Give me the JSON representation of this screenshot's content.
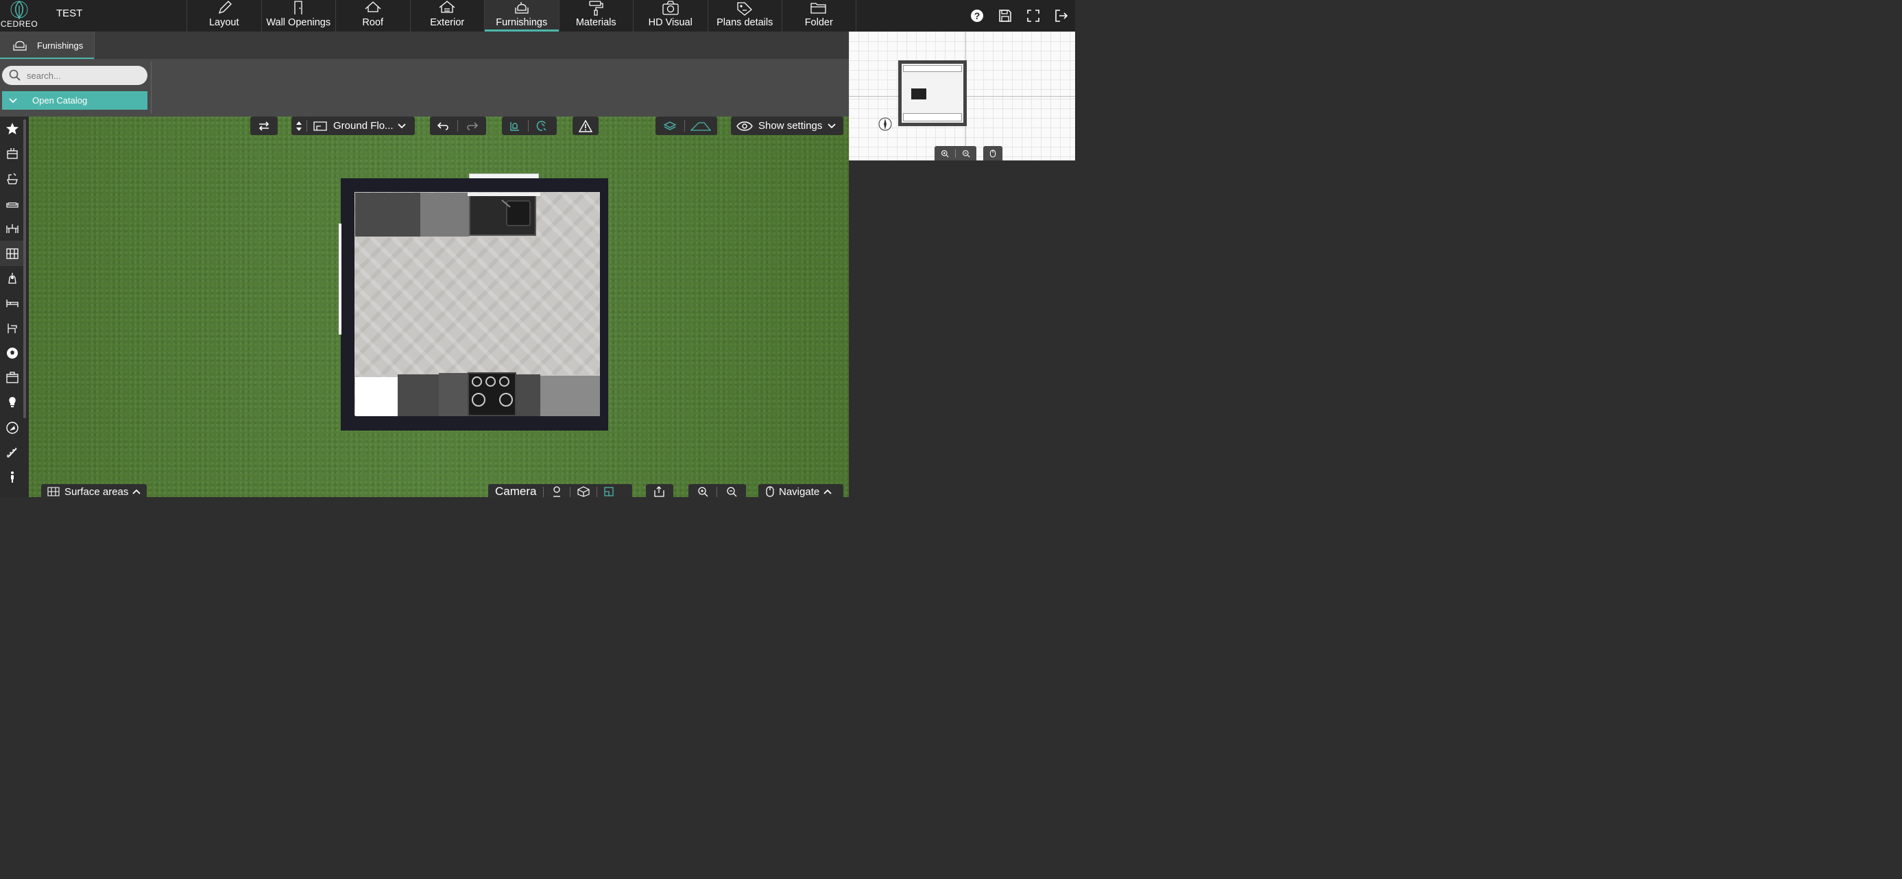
{
  "app": {
    "logo_text": "CEDREO",
    "project_title": "TEST"
  },
  "nav": {
    "items": [
      {
        "label": "Layout",
        "icon": "pencil-icon"
      },
      {
        "label": "Wall Openings",
        "icon": "door-icon"
      },
      {
        "label": "Roof",
        "icon": "roof-icon"
      },
      {
        "label": "Exterior",
        "icon": "exterior-icon"
      },
      {
        "label": "Furnishings",
        "icon": "armchair-icon",
        "active": true
      },
      {
        "label": "Materials",
        "icon": "paint-roller-icon"
      },
      {
        "label": "HD Visual",
        "icon": "camera-icon"
      },
      {
        "label": "Plans details",
        "icon": "plans-details-icon"
      },
      {
        "label": "Folder",
        "icon": "folder-icon"
      }
    ]
  },
  "top_right": [
    "help-icon",
    "save-icon",
    "fullscreen-icon",
    "logout-icon"
  ],
  "tab": {
    "label": "Furnishings"
  },
  "catalog": {
    "search_placeholder": "search...",
    "open_catalog_label": "Open Catalog"
  },
  "left_tools": [
    "star-icon",
    "kitchen-cabinet-icon",
    "bathroom-icon",
    "living-room-icon",
    "dining-icon",
    "storage-icon",
    "decoration-icon",
    "bedroom-icon",
    "office-icon",
    "leisure-icon",
    "appliance-icon",
    "lighting-icon",
    "outdoor-icon",
    "stairs-icon",
    "person-icon"
  ],
  "floating_toolbar": {
    "floor_label": "Ground Flo...",
    "settings_label": "Show settings"
  },
  "bottom_bar": {
    "surface_label": "Surface areas",
    "camera_label": "Camera",
    "navigate_label": "Navigate"
  },
  "colors": {
    "accent": "#4db6ac",
    "topbar": "#232323",
    "grass": "#4f7a32"
  }
}
